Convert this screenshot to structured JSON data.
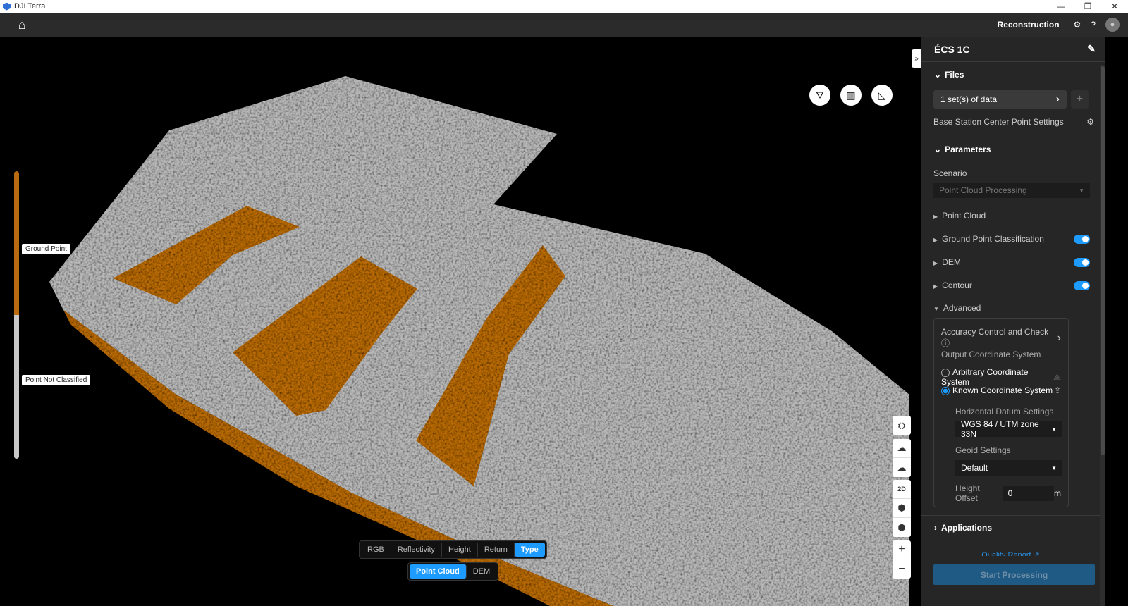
{
  "window": {
    "title": "DJI Terra",
    "minimize": "—",
    "restore": "❐",
    "close": "✕"
  },
  "topbar": {
    "home_icon": "⌂",
    "mode": "Reconstruction",
    "settings_icon": "⚙",
    "help_icon": "?",
    "avatar_icon": "●"
  },
  "viewport": {
    "tools": [
      "⛛",
      "▥",
      "◺"
    ],
    "collapse": "»",
    "legend": {
      "ground": "Ground Point",
      "unclassified": "Point Not Classified",
      "ground_color": "#b86a10",
      "unclassified_color": "#c8c8c8"
    },
    "side_tools": [
      "⛭",
      "☁",
      "☁",
      "2D",
      "⬢",
      "⬢",
      "+",
      "−"
    ],
    "color_modes": [
      "RGB",
      "Reflectivity",
      "Height",
      "Return",
      "Type"
    ],
    "active_color_mode": "Type",
    "view_modes": [
      "Point Cloud",
      "DEM"
    ],
    "active_view_mode": "Point Cloud"
  },
  "panel": {
    "title": "ÉCS 1C",
    "edit_icon": "✎",
    "files": {
      "header": "Files",
      "dataset": "1 set(s) of data",
      "add": "+",
      "base_station": "Base Station Center Point Settings"
    },
    "parameters": {
      "header": "Parameters",
      "scenario_label": "Scenario",
      "scenario_value": "Point Cloud Processing",
      "items": [
        {
          "label": "Point Cloud"
        },
        {
          "label": "Ground Point Classification",
          "enabled": true
        },
        {
          "label": "DEM",
          "enabled": true
        },
        {
          "label": "Contour",
          "enabled": true
        }
      ],
      "advanced": "Advanced"
    },
    "advanced": {
      "accuracy": "Accuracy Control and Check",
      "info_icon": "ⓘ",
      "output_cs": "Output Coordinate System",
      "arbitrary": "Arbitrary Coordinate System",
      "known": "Known Coordinate System",
      "selected": "Known Coordinate System",
      "horizontal_label": "Horizontal Datum Settings",
      "horizontal_value": "WGS 84 / UTM zone 33N",
      "geoid_label": "Geoid Settings",
      "geoid_value": "Default",
      "height_label": "Height Offset",
      "height_value": "0",
      "height_unit": "m"
    },
    "applications": "Applications",
    "quality_report": "Quality Report ↗",
    "start": "Start Processing"
  },
  "colors": {
    "accent": "#1e9bff",
    "ground": "#b86a10"
  }
}
